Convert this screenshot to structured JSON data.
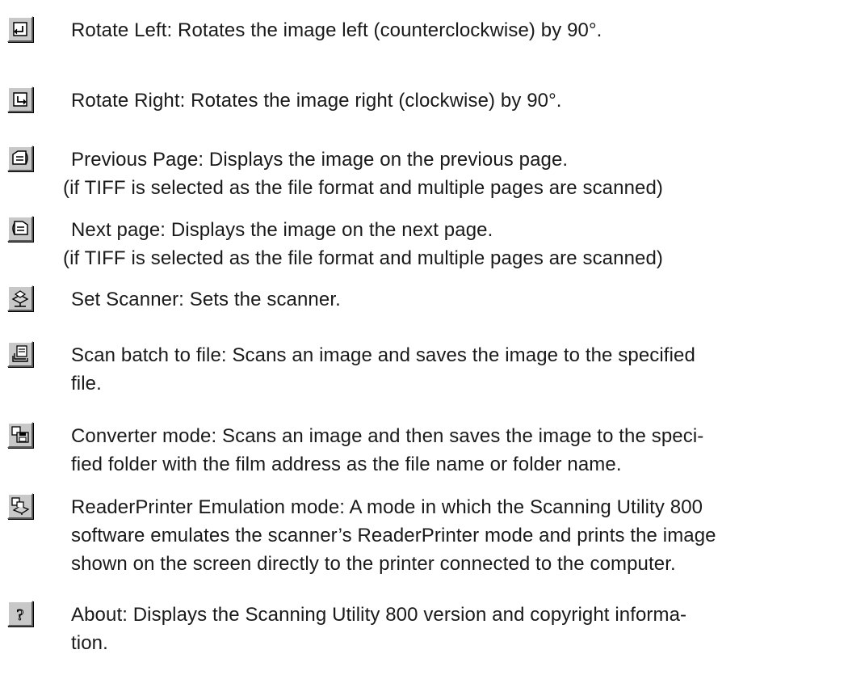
{
  "entries": [
    {
      "icon": "rotate-left-icon",
      "lines": [
        "Rotate Left: Rotates the image left (counterclockwise) by 90°."
      ]
    },
    {
      "icon": "rotate-right-icon",
      "lines": [
        "Rotate Right: Rotates the image right (clockwise) by 90°."
      ]
    },
    {
      "icon": "previous-page-icon",
      "lines": [
        "Previous Page: Displays the image on the previous page.",
        "(if TIFF is selected as the file format and multiple pages are scanned)"
      ]
    },
    {
      "icon": "next-page-icon",
      "lines": [
        "Next page: Displays the image on the next page.",
        "(if TIFF is selected as the file format and multiple pages are scanned)"
      ]
    },
    {
      "icon": "set-scanner-icon",
      "lines": [
        "Set Scanner: Sets the scanner."
      ]
    },
    {
      "icon": "scan-batch-to-file-icon",
      "lines": [
        "Scan batch to file: Scans an image and saves the image to the specified",
        "file."
      ]
    },
    {
      "icon": "converter-mode-icon",
      "lines": [
        "Converter mode: Scans an image and then saves the image to the speci-",
        "fied folder with the film address as the file name or folder name."
      ]
    },
    {
      "icon": "readerprinter-emulation-icon",
      "lines": [
        "ReaderPrinter Emulation mode: A mode in which the Scanning Utility 800",
        "software emulates the scanner’s ReaderPrinter mode and prints the image",
        "shown on the screen directly to the printer connected to the computer."
      ]
    },
    {
      "icon": "about-icon",
      "lines": [
        "About: Displays the Scanning Utility 800 version and copyright informa-",
        "tion."
      ]
    }
  ]
}
